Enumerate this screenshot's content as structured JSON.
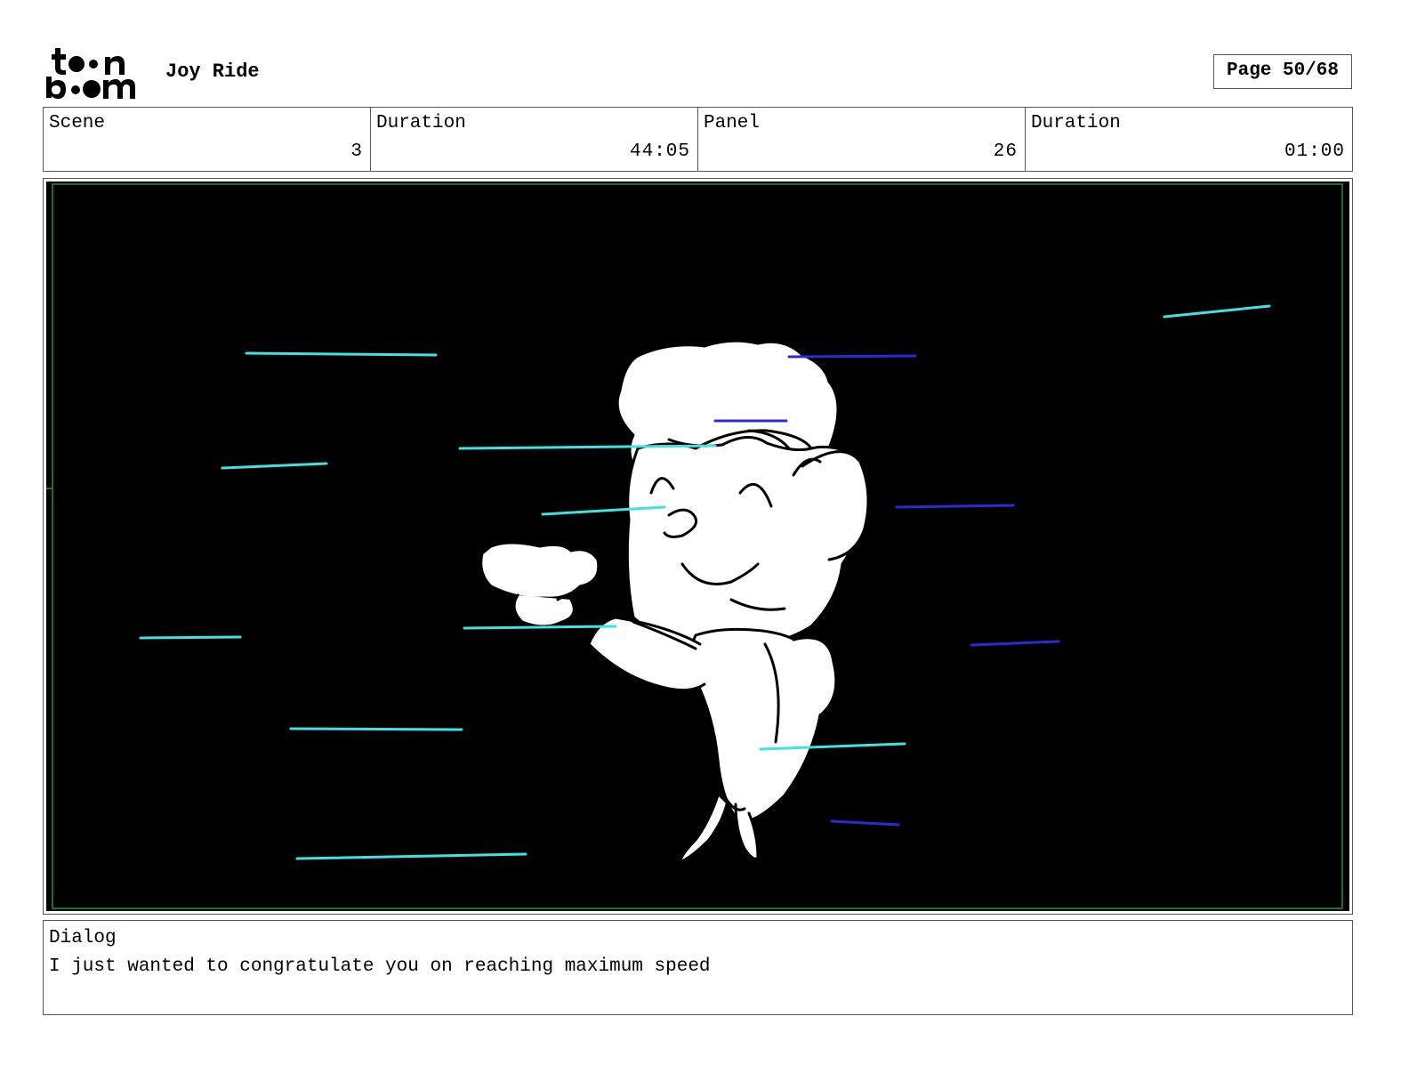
{
  "header": {
    "logo": {
      "icon": "toonboom-logo",
      "text": "toon boom"
    },
    "project_title": "Joy Ride",
    "page_label": "Page 50/68"
  },
  "info": {
    "scene_label": "Scene",
    "scene_value": "3",
    "scene_duration_label": "Duration",
    "scene_duration_value": "44:05",
    "panel_label": "Panel",
    "panel_value": "26",
    "panel_duration_label": "Duration",
    "panel_duration_value": "01:00"
  },
  "panel": {
    "background_color": "#000000",
    "frame_color": "#1f6b2a",
    "character_color": "#ffffff",
    "speed_line_cyan": "#3fe3e0",
    "speed_line_blue": "#2a2ad8"
  },
  "dialog": {
    "label": "Dialog",
    "text": "I just wanted to congratulate you on reaching maximum speed"
  }
}
